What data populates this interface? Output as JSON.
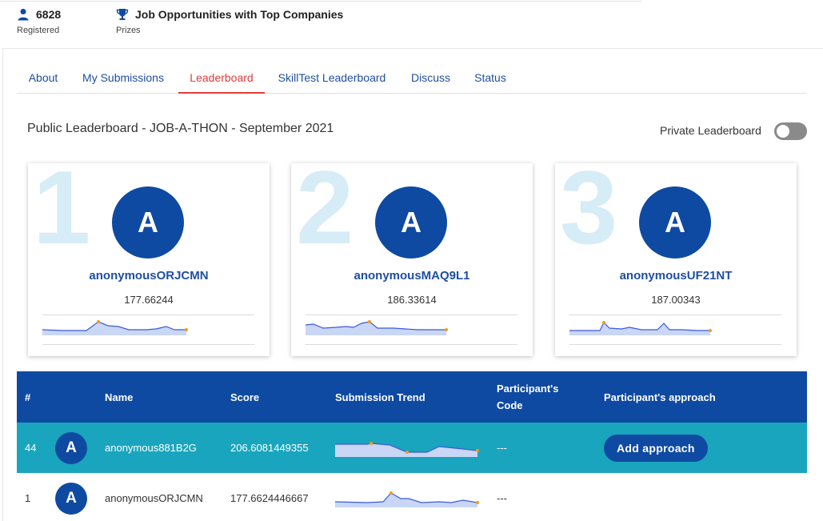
{
  "stats": {
    "registered": {
      "value": "6828",
      "label": "Registered",
      "icon": "user-icon"
    },
    "prizes": {
      "value": "Job Opportunities with Top Companies",
      "label": "Prizes",
      "icon": "trophy-icon"
    }
  },
  "tabs": [
    {
      "label": "About",
      "active": false
    },
    {
      "label": "My Submissions",
      "active": false
    },
    {
      "label": "Leaderboard",
      "active": true
    },
    {
      "label": "SkillTest Leaderboard",
      "active": false
    },
    {
      "label": "Discuss",
      "active": false
    },
    {
      "label": "Status",
      "active": false
    }
  ],
  "leaderboard": {
    "title": "Public Leaderboard - JOB-A-THON - September 2021",
    "private_toggle_label": "Private Leaderboard",
    "private_enabled": false
  },
  "podium": [
    {
      "rank": "1",
      "initial": "A",
      "name": "anonymousORJCMN",
      "score": "177.66244"
    },
    {
      "rank": "2",
      "initial": "A",
      "name": "anonymousMAQ9L1",
      "score": "186.33614"
    },
    {
      "rank": "3",
      "initial": "A",
      "name": "anonymousUF21NT",
      "score": "187.00343"
    }
  ],
  "table": {
    "headers": {
      "rank": "#",
      "name": "Name",
      "score": "Score",
      "trend": "Submission Trend",
      "code_line1": "Participant's",
      "code_line2": "Code",
      "approach": "Participant's approach"
    },
    "rows": [
      {
        "rank": "44",
        "initial": "A",
        "name": "anonymous881B2G",
        "score": "206.6081449355",
        "code": "---",
        "approach_button": "Add approach",
        "highlight": true
      },
      {
        "rank": "1",
        "initial": "A",
        "name": "anonymousORJCMN",
        "score": "177.6624446667",
        "code": "---",
        "approach_button": "",
        "highlight": false
      }
    ]
  },
  "colors": {
    "primary": "#0f4aa2",
    "highlight_row": "#19a5bd",
    "active_tab": "#e23b3b",
    "link": "#1e4fa1",
    "rank_watermark": "#d6ecf6",
    "spark_line": "#3b5bdb",
    "spark_fill": "#c9d6f5",
    "spark_marker": "#f39c12"
  }
}
